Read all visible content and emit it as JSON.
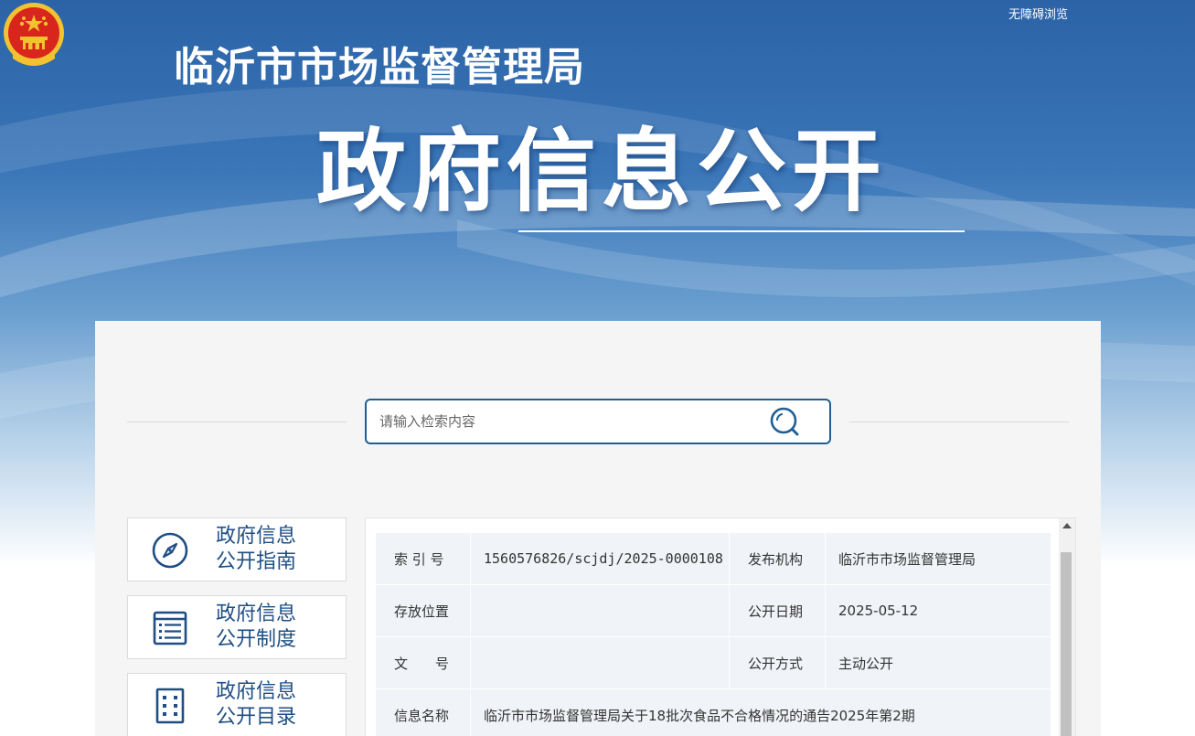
{
  "header": {
    "accessibility_link": "无障碍浏览",
    "agency_name": "临沂市市场监督管理局",
    "hero_title": "政府信息公开"
  },
  "search": {
    "placeholder": "请输入检索内容"
  },
  "sidebar": {
    "items": [
      {
        "line1": "政府信息",
        "line2": "公开指南",
        "icon": "compass-icon"
      },
      {
        "line1": "政府信息",
        "line2": "公开制度",
        "icon": "document-list-icon"
      },
      {
        "line1": "政府信息",
        "line2": "公开目录",
        "icon": "directory-grid-icon"
      }
    ]
  },
  "detail": {
    "index_label": "索 引 号",
    "index_value": "1560576826/scjdj/2025-0000108",
    "publisher_label": "发布机构",
    "publisher_value": "临沂市市场监督管理局",
    "location_label": "存放位置",
    "location_value": "",
    "date_label": "公开日期",
    "date_value": "2025-05-12",
    "doc_no_label": "文　　号",
    "doc_no_value": "",
    "mode_label": "公开方式",
    "mode_value": "主动公开",
    "name_label": "信息名称",
    "name_value": "临沂市市场监督管理局关于18批次食品不合格情况的通告2025年第2期"
  },
  "colors": {
    "banner_blue": "#2b63a6",
    "accent": "#1f5f93",
    "nav_text": "#1f4e85",
    "emblem_red": "#d8261c",
    "emblem_gold": "#f2c230"
  }
}
